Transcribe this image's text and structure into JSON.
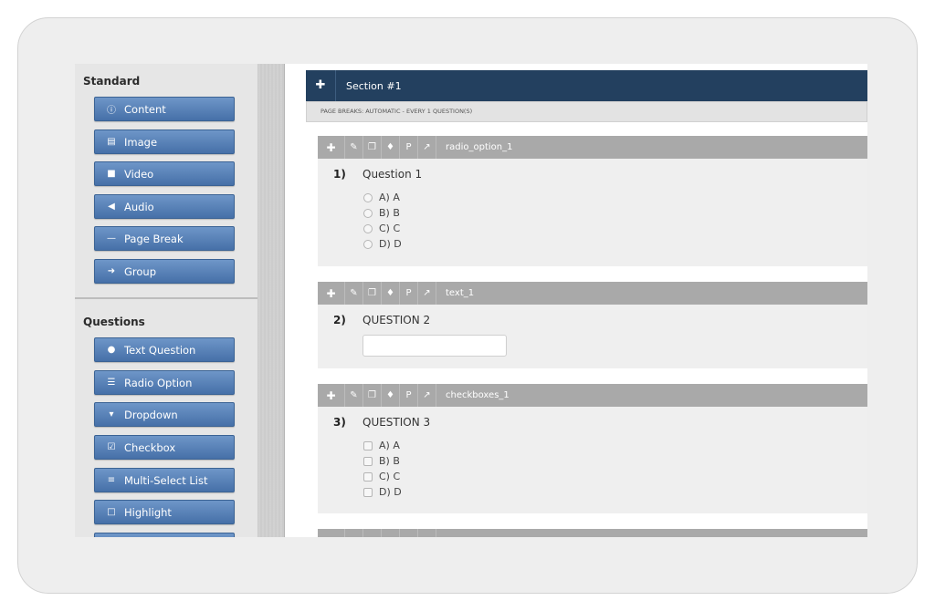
{
  "sidebar": {
    "standard_heading": "Standard",
    "standard_items": [
      {
        "label": "Content",
        "icon": "info-icon"
      },
      {
        "label": "Image",
        "icon": "image-icon"
      },
      {
        "label": "Video",
        "icon": "video-icon"
      },
      {
        "label": "Audio",
        "icon": "audio-icon"
      },
      {
        "label": "Page Break",
        "icon": "minus-icon"
      },
      {
        "label": "Group",
        "icon": "group-icon"
      }
    ],
    "questions_heading": "Questions",
    "question_items": [
      {
        "label": "Text Question",
        "icon": "comment-icon"
      },
      {
        "label": "Radio Option",
        "icon": "list-icon"
      },
      {
        "label": "Dropdown",
        "icon": "caret-down-icon"
      },
      {
        "label": "Checkbox",
        "icon": "checkbox-icon"
      },
      {
        "label": "Multi-Select List",
        "icon": "menu-icon"
      },
      {
        "label": "Highlight",
        "icon": "square-icon"
      }
    ]
  },
  "section": {
    "title": "Section #1",
    "page_breaks": "PAGE BREAKS: AUTOMATIC - EVERY 1 QUESTION(S)"
  },
  "questions": [
    {
      "number": "1)",
      "name": "radio_option_1",
      "text": "Question 1",
      "options": [
        "A)  A",
        "B)  B",
        "C)  C",
        "D)  D"
      ]
    },
    {
      "number": "2)",
      "name": "text_1",
      "text": "QUESTION 2",
      "input_value": ""
    },
    {
      "number": "3)",
      "name": "checkboxes_1",
      "text": "QUESTION 3",
      "options": [
        "A)  A",
        "B)  B",
        "C)  C",
        "D)  D"
      ]
    }
  ],
  "colors": {
    "section_bar": "#23405f",
    "question_header": "#a9a9a9",
    "sidebar_button": "#5580b8"
  }
}
